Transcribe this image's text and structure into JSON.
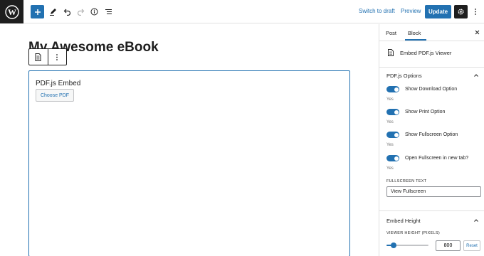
{
  "topbar": {
    "switch_to_draft": "Switch to draft",
    "preview": "Preview",
    "update": "Update"
  },
  "editor": {
    "post_title": "My Awesome eBook",
    "embed_block_title": "PDF.js Embed",
    "choose_pdf": "Choose PDF"
  },
  "sidebar": {
    "tabs": [
      "Post",
      "Block"
    ],
    "active_tab": "Block",
    "block_name": "Embed PDF.js Viewer",
    "options_panel": {
      "title": "PDF.js Options",
      "options": [
        {
          "label": "Show Download Option",
          "value": "Yes"
        },
        {
          "label": "Show Print Option",
          "value": "Yes"
        },
        {
          "label": "Show Fullscreen Option",
          "value": "Yes"
        },
        {
          "label": "Open Fullscreen in new tab?",
          "value": "Yes"
        }
      ],
      "fullscreen_text_label": "FULLSCREEN TEXT",
      "fullscreen_text_value": "View Fullscreen"
    },
    "height_panel": {
      "title": "Embed Height",
      "viewer_height_label": "VIEWER HEIGHT (PIXELS)",
      "viewer_height_value": "800",
      "reset": "Reset"
    }
  },
  "colors": {
    "accent": "#2271b1",
    "dark": "#1e1e1e"
  }
}
